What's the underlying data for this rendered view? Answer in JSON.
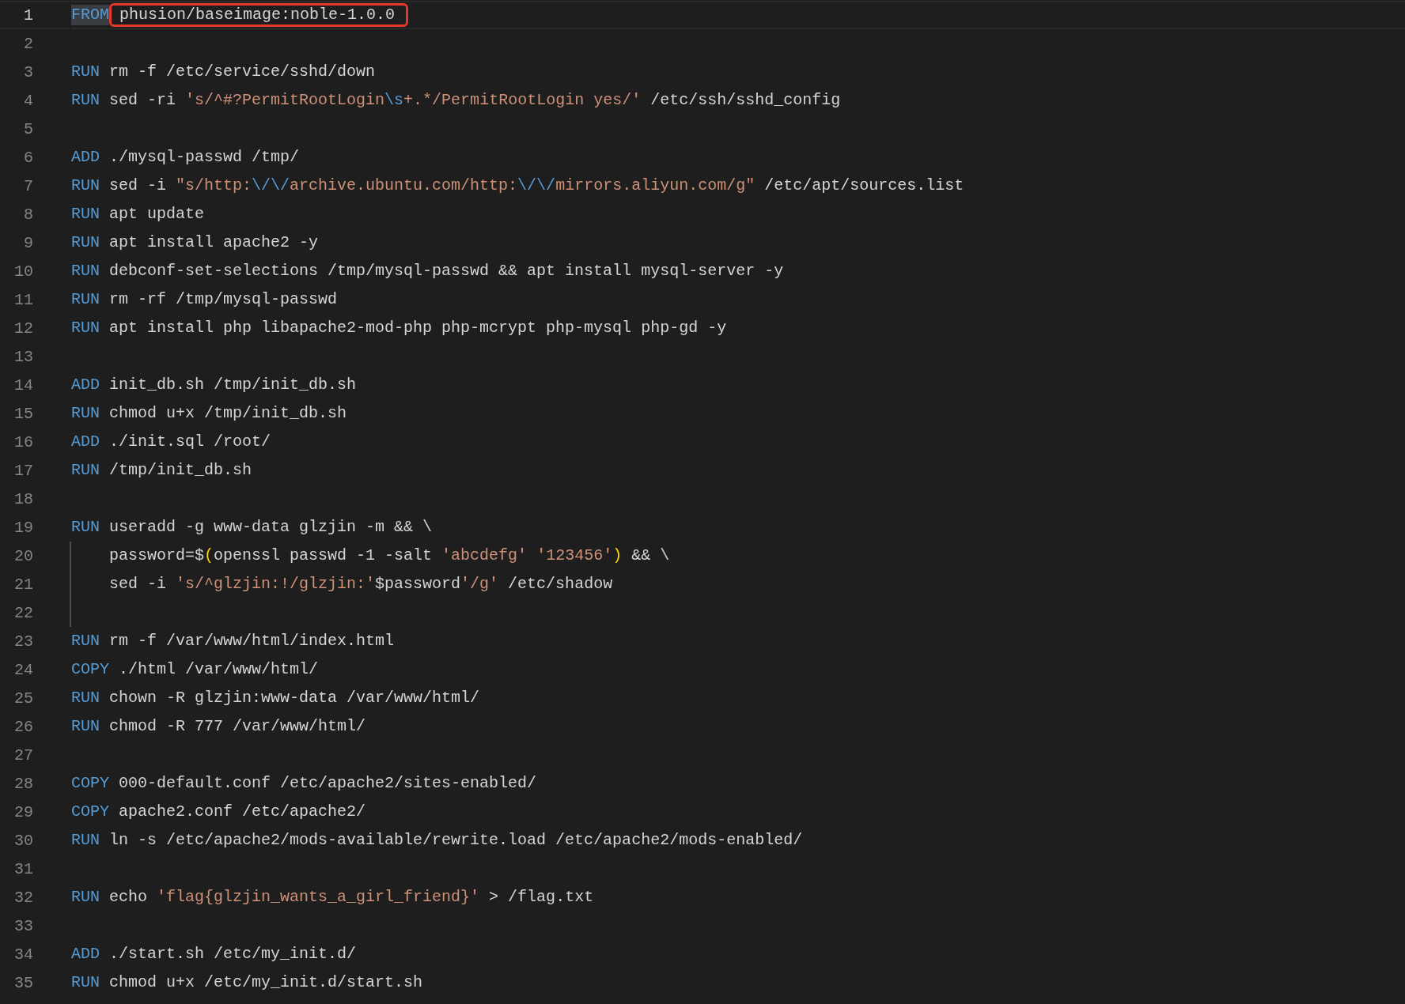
{
  "editor": {
    "lines": [
      {
        "number": "1",
        "current": true,
        "indented": false,
        "tokens": [
          {
            "kind": "keyword-match",
            "text": "FROM"
          },
          {
            "kind": "plain-circled",
            "text": "phusion/baseimage:noble-1.0.0"
          }
        ]
      },
      {
        "number": "2",
        "current": false,
        "indented": false
      },
      {
        "number": "3",
        "current": false,
        "indented": false,
        "tokens": [
          {
            "kind": "keyword",
            "text": "RUN"
          },
          {
            "kind": "plain",
            "text": " rm -f /etc/service/sshd/down"
          }
        ]
      },
      {
        "number": "4",
        "current": false,
        "indented": false,
        "tokens": [
          {
            "kind": "keyword",
            "text": "RUN"
          },
          {
            "kind": "plain",
            "text": " sed -ri "
          },
          {
            "kind": "string",
            "text": "'s/^#?PermitRootLogin"
          },
          {
            "kind": "escape",
            "text": "\\s"
          },
          {
            "kind": "string",
            "text": "+.*/PermitRootLogin yes/'"
          },
          {
            "kind": "plain",
            "text": " /etc/ssh/sshd_config"
          }
        ]
      },
      {
        "number": "5",
        "current": false,
        "indented": false
      },
      {
        "number": "6",
        "current": false,
        "indented": false,
        "tokens": [
          {
            "kind": "keyword",
            "text": "ADD"
          },
          {
            "kind": "plain",
            "text": " ./mysql-passwd /tmp/"
          }
        ]
      },
      {
        "number": "7",
        "current": false,
        "indented": false,
        "tokens": [
          {
            "kind": "keyword",
            "text": "RUN"
          },
          {
            "kind": "plain",
            "text": " sed -i "
          },
          {
            "kind": "string",
            "text": "\"s/http:"
          },
          {
            "kind": "escape",
            "text": "\\/\\/"
          },
          {
            "kind": "string",
            "text": "archive.ubuntu.com/http:"
          },
          {
            "kind": "escape",
            "text": "\\/\\/"
          },
          {
            "kind": "string",
            "text": "mirrors.aliyun.com/g\""
          },
          {
            "kind": "plain",
            "text": " /etc/apt/sources.list"
          }
        ]
      },
      {
        "number": "8",
        "current": false,
        "indented": false,
        "tokens": [
          {
            "kind": "keyword",
            "text": "RUN"
          },
          {
            "kind": "plain",
            "text": " apt update"
          }
        ]
      },
      {
        "number": "9",
        "current": false,
        "indented": false,
        "tokens": [
          {
            "kind": "keyword",
            "text": "RUN"
          },
          {
            "kind": "plain",
            "text": " apt install apache2 -y"
          }
        ]
      },
      {
        "number": "10",
        "current": false,
        "indented": false,
        "tokens": [
          {
            "kind": "keyword",
            "text": "RUN"
          },
          {
            "kind": "plain",
            "text": " debconf-set-selections /tmp/mysql-passwd && apt install mysql-server -y"
          }
        ]
      },
      {
        "number": "11",
        "current": false,
        "indented": false,
        "tokens": [
          {
            "kind": "keyword",
            "text": "RUN"
          },
          {
            "kind": "plain",
            "text": " rm -rf /tmp/mysql-passwd"
          }
        ]
      },
      {
        "number": "12",
        "current": false,
        "indented": false,
        "tokens": [
          {
            "kind": "keyword",
            "text": "RUN"
          },
          {
            "kind": "plain",
            "text": " apt install php libapache2-mod-php php-mcrypt php-mysql php-gd -y"
          }
        ]
      },
      {
        "number": "13",
        "current": false,
        "indented": false
      },
      {
        "number": "14",
        "current": false,
        "indented": false,
        "tokens": [
          {
            "kind": "keyword",
            "text": "ADD"
          },
          {
            "kind": "plain",
            "text": " init_db.sh /tmp/init_db.sh"
          }
        ]
      },
      {
        "number": "15",
        "current": false,
        "indented": false,
        "tokens": [
          {
            "kind": "keyword",
            "text": "RUN"
          },
          {
            "kind": "plain",
            "text": " chmod u+x /tmp/init_db.sh"
          }
        ]
      },
      {
        "number": "16",
        "current": false,
        "indented": false,
        "tokens": [
          {
            "kind": "keyword",
            "text": "ADD"
          },
          {
            "kind": "plain",
            "text": " ./init.sql /root/"
          }
        ]
      },
      {
        "number": "17",
        "current": false,
        "indented": false,
        "tokens": [
          {
            "kind": "keyword",
            "text": "RUN"
          },
          {
            "kind": "plain",
            "text": " /tmp/init_db.sh"
          }
        ]
      },
      {
        "number": "18",
        "current": false,
        "indented": false
      },
      {
        "number": "19",
        "current": false,
        "indented": false,
        "tokens": [
          {
            "kind": "keyword",
            "text": "RUN"
          },
          {
            "kind": "plain",
            "text": " useradd -g www-data glzjin -m && \\"
          }
        ]
      },
      {
        "number": "20",
        "current": false,
        "indented": true,
        "tokens": [
          {
            "kind": "plain",
            "text": "password=$"
          },
          {
            "kind": "paren",
            "text": "("
          },
          {
            "kind": "plain",
            "text": "openssl passwd -1 -salt "
          },
          {
            "kind": "string",
            "text": "'abcdefg' "
          },
          {
            "kind": "string",
            "text": "'123456'"
          },
          {
            "kind": "paren",
            "text": ")"
          },
          {
            "kind": "plain",
            "text": " && \\"
          }
        ]
      },
      {
        "number": "21",
        "current": false,
        "indented": true,
        "tokens": [
          {
            "kind": "plain",
            "text": "sed -i "
          },
          {
            "kind": "string",
            "text": "'s/^glzjin:!/glzjin:'"
          },
          {
            "kind": "plain",
            "text": "$password"
          },
          {
            "kind": "string",
            "text": "'/g'"
          },
          {
            "kind": "plain",
            "text": " /etc/shadow"
          }
        ]
      },
      {
        "number": "22",
        "current": false,
        "indented": true
      },
      {
        "number": "23",
        "current": false,
        "indented": false,
        "tokens": [
          {
            "kind": "keyword",
            "text": "RUN"
          },
          {
            "kind": "plain",
            "text": " rm -f /var/www/html/index.html"
          }
        ]
      },
      {
        "number": "24",
        "current": false,
        "indented": false,
        "tokens": [
          {
            "kind": "keyword",
            "text": "COPY"
          },
          {
            "kind": "plain",
            "text": " ./html /var/www/html/"
          }
        ]
      },
      {
        "number": "25",
        "current": false,
        "indented": false,
        "tokens": [
          {
            "kind": "keyword",
            "text": "RUN"
          },
          {
            "kind": "plain",
            "text": " chown -R glzjin:www-data /var/www/html/"
          }
        ]
      },
      {
        "number": "26",
        "current": false,
        "indented": false,
        "tokens": [
          {
            "kind": "keyword",
            "text": "RUN"
          },
          {
            "kind": "plain",
            "text": " chmod -R 777 /var/www/html/"
          }
        ]
      },
      {
        "number": "27",
        "current": false,
        "indented": false
      },
      {
        "number": "28",
        "current": false,
        "indented": false,
        "tokens": [
          {
            "kind": "keyword",
            "text": "COPY"
          },
          {
            "kind": "plain",
            "text": " 000-default.conf /etc/apache2/sites-enabled/"
          }
        ]
      },
      {
        "number": "29",
        "current": false,
        "indented": false,
        "tokens": [
          {
            "kind": "keyword",
            "text": "COPY"
          },
          {
            "kind": "plain",
            "text": " apache2.conf /etc/apache2/"
          }
        ]
      },
      {
        "number": "30",
        "current": false,
        "indented": false,
        "tokens": [
          {
            "kind": "keyword",
            "text": "RUN"
          },
          {
            "kind": "plain",
            "text": " ln -s /etc/apache2/mods-available/rewrite.load /etc/apache2/mods-enabled/"
          }
        ]
      },
      {
        "number": "31",
        "current": false,
        "indented": false
      },
      {
        "number": "32",
        "current": false,
        "indented": false,
        "tokens": [
          {
            "kind": "keyword",
            "text": "RUN"
          },
          {
            "kind": "plain",
            "text": " echo "
          },
          {
            "kind": "string",
            "text": "'flag{glzjin_wants_a_girl_friend}'"
          },
          {
            "kind": "plain",
            "text": " > /flag.txt"
          }
        ]
      },
      {
        "number": "33",
        "current": false,
        "indented": false
      },
      {
        "number": "34",
        "current": false,
        "indented": false,
        "tokens": [
          {
            "kind": "keyword",
            "text": "ADD"
          },
          {
            "kind": "plain",
            "text": " ./start.sh /etc/my_init.d/"
          }
        ]
      },
      {
        "number": "35",
        "current": false,
        "indented": false,
        "tokens": [
          {
            "kind": "keyword",
            "text": "RUN"
          },
          {
            "kind": "plain",
            "text": " chmod u+x /etc/my_init.d/start.sh"
          }
        ]
      }
    ]
  }
}
